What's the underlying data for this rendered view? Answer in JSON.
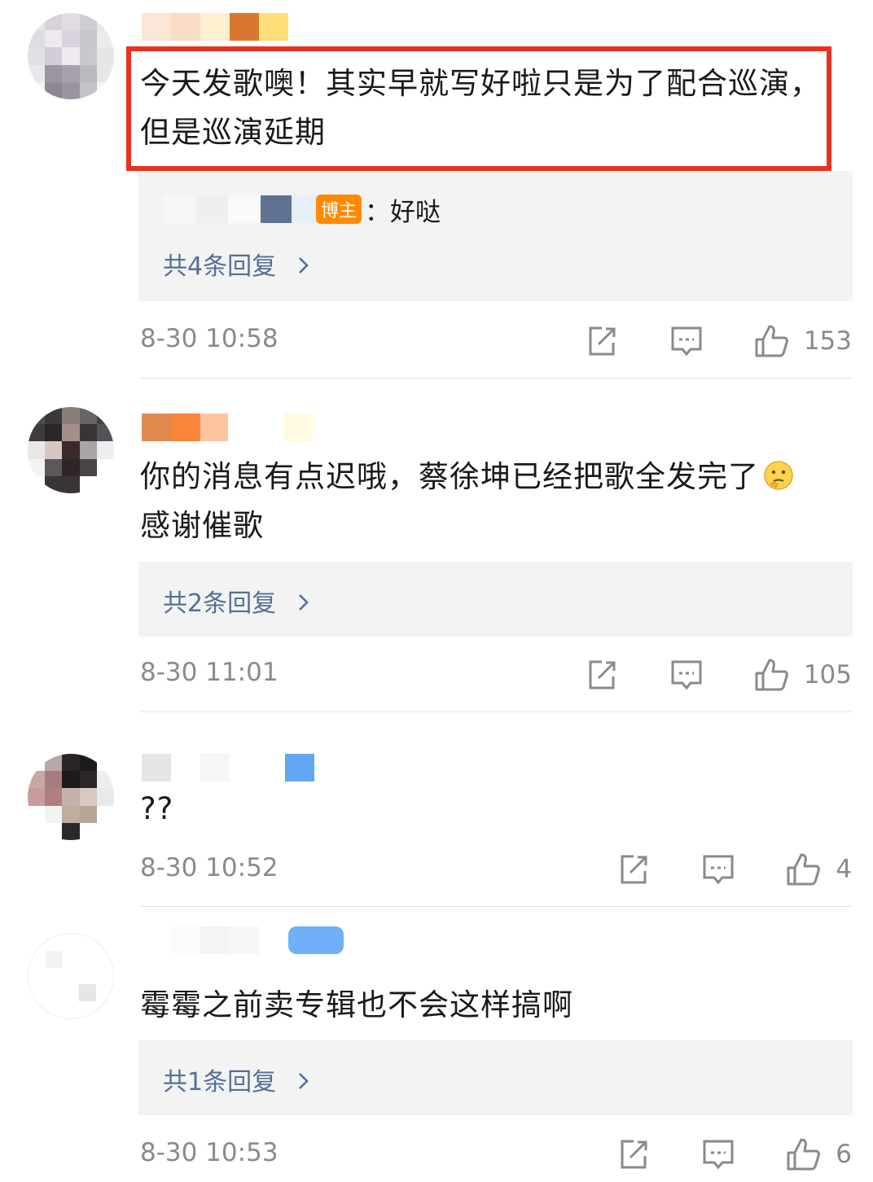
{
  "comments": [
    {
      "text": "今天发歌噢！其实早就写好啦只是为了配合巡演，但是巡演延期",
      "reply": {
        "badge": "博主",
        "sep": "：",
        "text": "好哒"
      },
      "more_replies": "共4条回复",
      "time": "8-30 10:58",
      "likes": "153"
    },
    {
      "text": "你的消息有点迟哦，蔡徐坤已经把歌全发完了",
      "text2": "感谢催歌",
      "more_replies": "共2条回复",
      "time": "8-30 11:01",
      "likes": "105"
    },
    {
      "text": "??",
      "time": "8-30 10:52",
      "likes": "4"
    },
    {
      "text": "霉霉之前卖专辑也不会这样搞啊",
      "more_replies": "共1条回复",
      "time": "8-30 10:53",
      "likes": "6"
    }
  ],
  "icons": {
    "share": "share-icon",
    "comment": "comment-icon",
    "like": "thumbs-up-icon",
    "chevron": "chevron-right-icon",
    "emoji": "thinking-emoji-icon"
  },
  "colors": {
    "highlight_border": "#e8321f",
    "link": "#546f96",
    "badge": "#ff8a00"
  }
}
